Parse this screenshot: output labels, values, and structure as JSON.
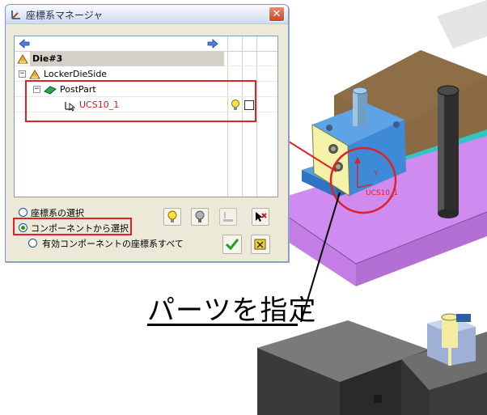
{
  "dialog": {
    "title": "座標系マネージャ",
    "close_glyph": "✕",
    "tree": {
      "rows": [
        {
          "label": "Die#3"
        },
        {
          "label": "LockerDieSide"
        },
        {
          "label": "PostPart"
        },
        {
          "label": "UCS10_1"
        }
      ]
    },
    "options": [
      {
        "label": "座標系の選択",
        "checked": false
      },
      {
        "label": "コンポーネントから選択",
        "checked": true
      },
      {
        "label": "有効コンポーネントの座標系すべて",
        "checked": false
      }
    ],
    "buttons": [
      "lightbulb-on",
      "lightbulb-off",
      "move-to-ground",
      "cursor-delete",
      "ok-check",
      "reset"
    ]
  },
  "model": {
    "axis_y": "Y",
    "axis_label": "UCS10_1"
  },
  "callout": {
    "text": "パーツを指定"
  },
  "colors": {
    "highlight_red": "#e0202a",
    "plate_purple": "#cc88ee",
    "block_blue": "#3f8ad6",
    "block_yellow": "#f4f2a6",
    "dark_gray": "#3c3c3c",
    "wood_brown": "#8a6c44"
  }
}
